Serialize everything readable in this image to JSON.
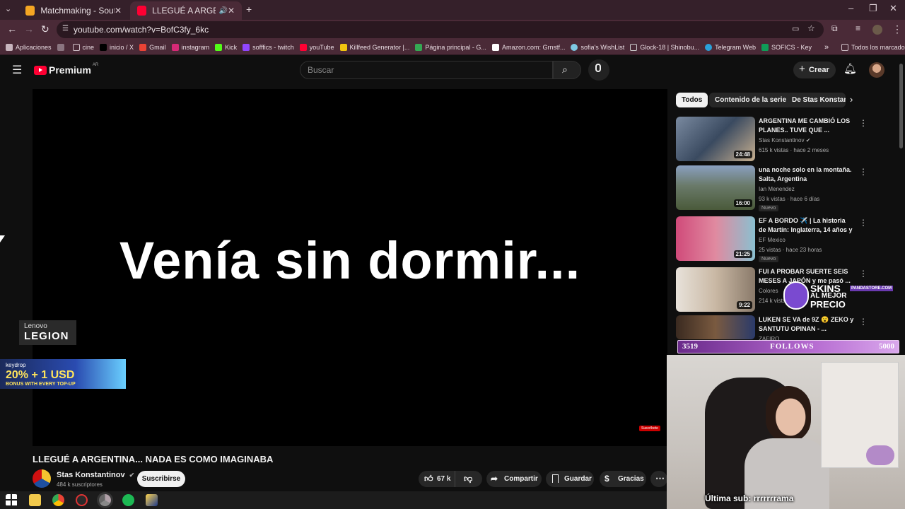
{
  "browser": {
    "tabs": [
      {
        "title": "Matchmaking - South America",
        "active": false
      },
      {
        "title": "LLEGUÉ A ARGENTINA... NA",
        "active": true
      }
    ],
    "url": "youtube.com/watch?v=BofC3fy_6kc",
    "bookmarks": [
      "Aplicaciones",
      "cine",
      "inicio / X",
      "Gmail",
      "instagram",
      "Kick",
      "sofffics - twitch",
      "youTube",
      "Killfeed Generator |...",
      "Página principal - G...",
      "Amazon.com: Grnstf...",
      "sofia's WishList",
      "Glock-18 | Shinobu...",
      "Telegram Web",
      "SOFICS - Key"
    ],
    "all_bookmarks": "Todos los marcadores"
  },
  "youtube": {
    "logo": "Premium",
    "region": "AR",
    "search_placeholder": "Buscar",
    "create_label": "Crear"
  },
  "video": {
    "caption": "Venía sin dormir...",
    "subscribe_watermark": "Suscríbete",
    "title": "LLEGUÉ A ARGENTINA... NADA ES COMO IMAGINABA",
    "channel": "Stas Konstantinov",
    "subscribers": "484 k suscriptores",
    "subscribe_label": "Suscribirse",
    "likes": "67 k",
    "share_label": "Compartir",
    "save_label": "Guardar",
    "thanks_label": "Gracias"
  },
  "chips": [
    "Todos",
    "Contenido de la serie",
    "De Stas Konstan"
  ],
  "recommendations": [
    {
      "title": "ARGENTINA ME CAMBIÓ LOS PLANES.. TUVE QUE ...",
      "channel": "Stas Konstantinov",
      "meta": "615 k vistas · hace 2 meses",
      "duration": "24:48",
      "badge": ""
    },
    {
      "title": "una noche solo en la montaña. Salta, Argentina",
      "channel": "Ian Menendez",
      "meta": "93 k vistas · hace 6 días",
      "duration": "16:00",
      "badge": "Nuevo"
    },
    {
      "title": "EF A BORDO ✈️ | La historia de Martín: Inglaterra, 14 años y s...",
      "channel": "EF Mexico",
      "meta": "25 vistas · hace 23 horas",
      "duration": "21:25",
      "badge": "Nuevo"
    },
    {
      "title": "FUI A PROBAR SUERTE SEIS MESES A JAPÓN y me pasó ...",
      "channel": "Colores",
      "meta": "214 k vistas",
      "duration": "9:22",
      "badge": ""
    },
    {
      "title": "LUKEN SE VA de 9Z 😮 ZEKO y SANTUTU OPINAN - ...",
      "channel": "ZAFIRO",
      "meta": "",
      "duration": "",
      "badge": ""
    }
  ],
  "overlays": {
    "lenovo_top": "Lenovo",
    "lenovo_bottom": "LEGION",
    "keydrop_brand": "keydrop",
    "keydrop_offer": "20% + 1 USD",
    "keydrop_sub": "BONUS WITH EVERY TOP-UP",
    "follows_current": "3519",
    "follows_label": "FOLLOWS",
    "follows_goal": "5000",
    "skins_line1": "SKINS",
    "skins_line2": "AL MEJOR",
    "skins_line3": "PRECIO",
    "skins_site": "PANDASTORE.COM",
    "last_sub": "Última sub: rrrrrrrama"
  }
}
